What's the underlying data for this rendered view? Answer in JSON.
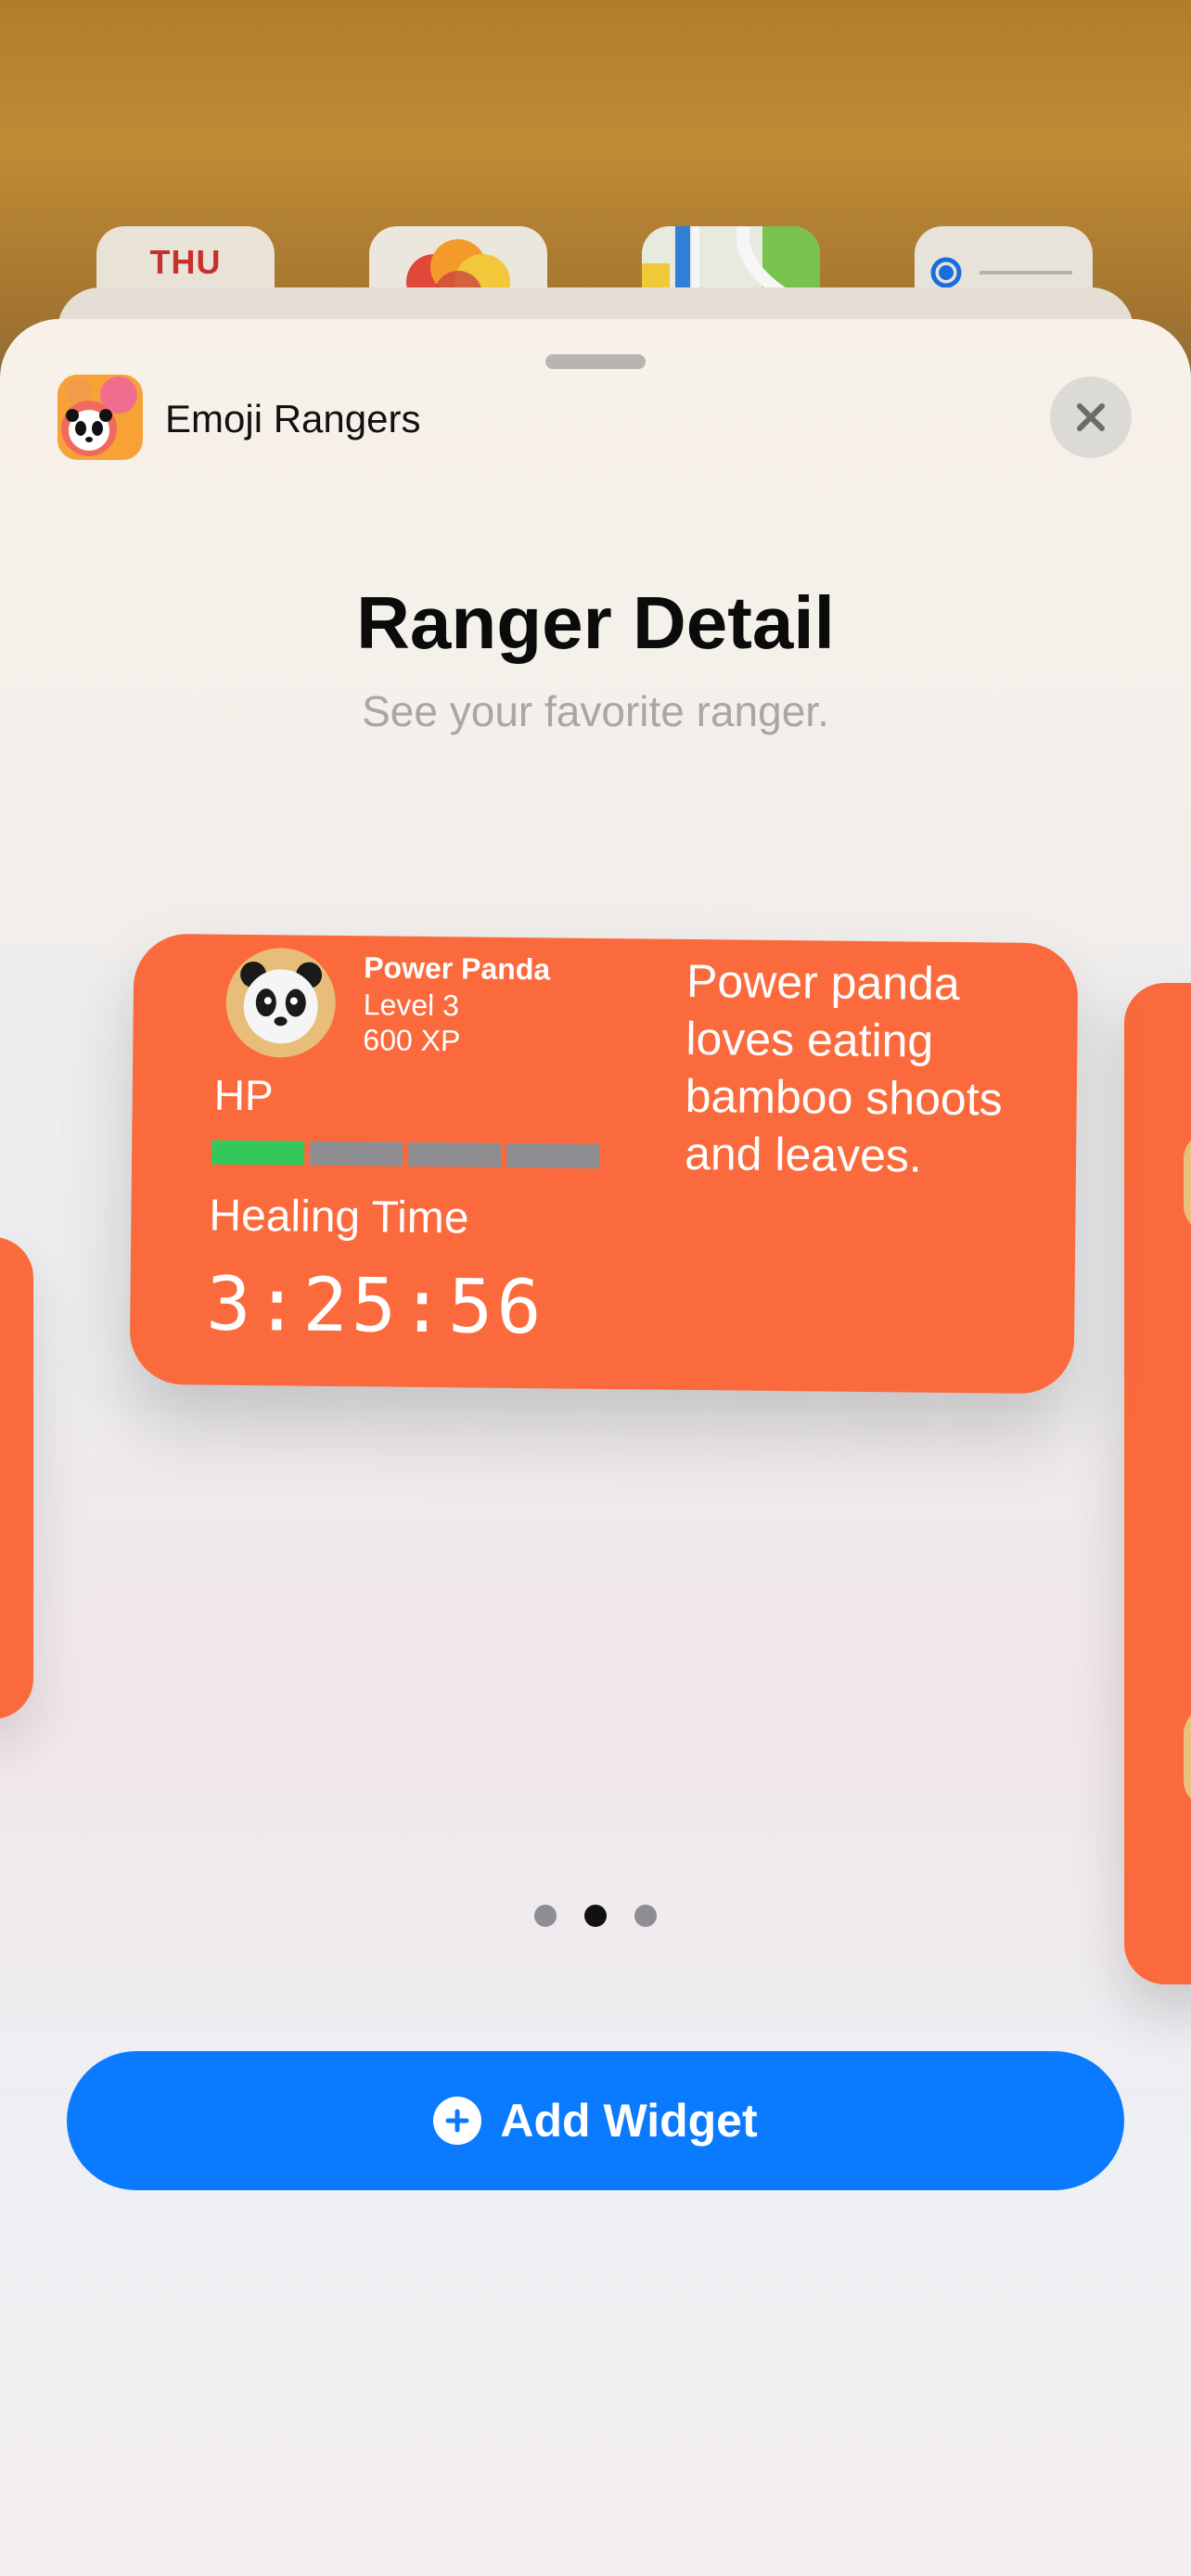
{
  "background": {
    "calendar_day": "THU"
  },
  "sheet": {
    "app_name": "Emoji Rangers",
    "title": "Ranger Detail",
    "subtitle": "See your favorite ranger."
  },
  "widget": {
    "ranger_name": "Power Panda",
    "level": "Level 3",
    "xp": "600 XP",
    "hp_label": "HP",
    "hp_fraction": 0.25,
    "healing_label": "Healing Time",
    "healing_time": "3:25:56",
    "description": "Power panda loves eating bamboo shoots and leaves.",
    "accent_color": "#fb6a3d"
  },
  "pager": {
    "count": 3,
    "active_index": 1
  },
  "add_button": {
    "label": "Add Widget",
    "color": "#0a7aff"
  }
}
